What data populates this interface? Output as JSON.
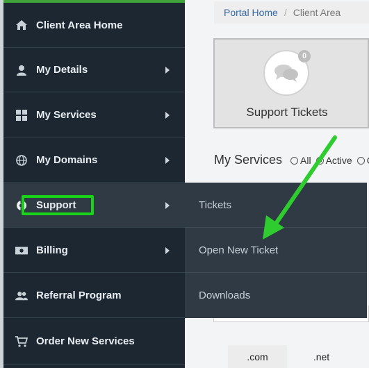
{
  "sidebar": {
    "items": [
      {
        "label": "Client Area Home",
        "icon": "home-icon"
      },
      {
        "label": "My Details",
        "icon": "user-icon"
      },
      {
        "label": "My Services",
        "icon": "grid-icon"
      },
      {
        "label": "My Domains",
        "icon": "globe-icon"
      },
      {
        "label": "Support",
        "icon": "life-ring-icon"
      },
      {
        "label": "Billing",
        "icon": "money-icon"
      },
      {
        "label": "Referral Program",
        "icon": "users-icon"
      },
      {
        "label": "Order New Services",
        "icon": "cart-icon"
      }
    ]
  },
  "support_menu": {
    "items": [
      "Tickets",
      "Open New Ticket",
      "Downloads"
    ]
  },
  "breadcrumb": {
    "home": "Portal Home",
    "separator": "/",
    "current": "Client Area"
  },
  "tile": {
    "label": "Support Tickets",
    "badge": "0",
    "icon": "chat-bubbles-icon"
  },
  "services": {
    "title": "My Services",
    "filters": [
      "All",
      "Active",
      "C"
    ],
    "selected_filter": "Active"
  },
  "domain_tabs": [
    ".com",
    ".net"
  ],
  "colors": {
    "sidebar_bg": "#1c2731",
    "highlight": "#19d319",
    "arrow": "#2ecc2e",
    "link": "#356aa0"
  }
}
